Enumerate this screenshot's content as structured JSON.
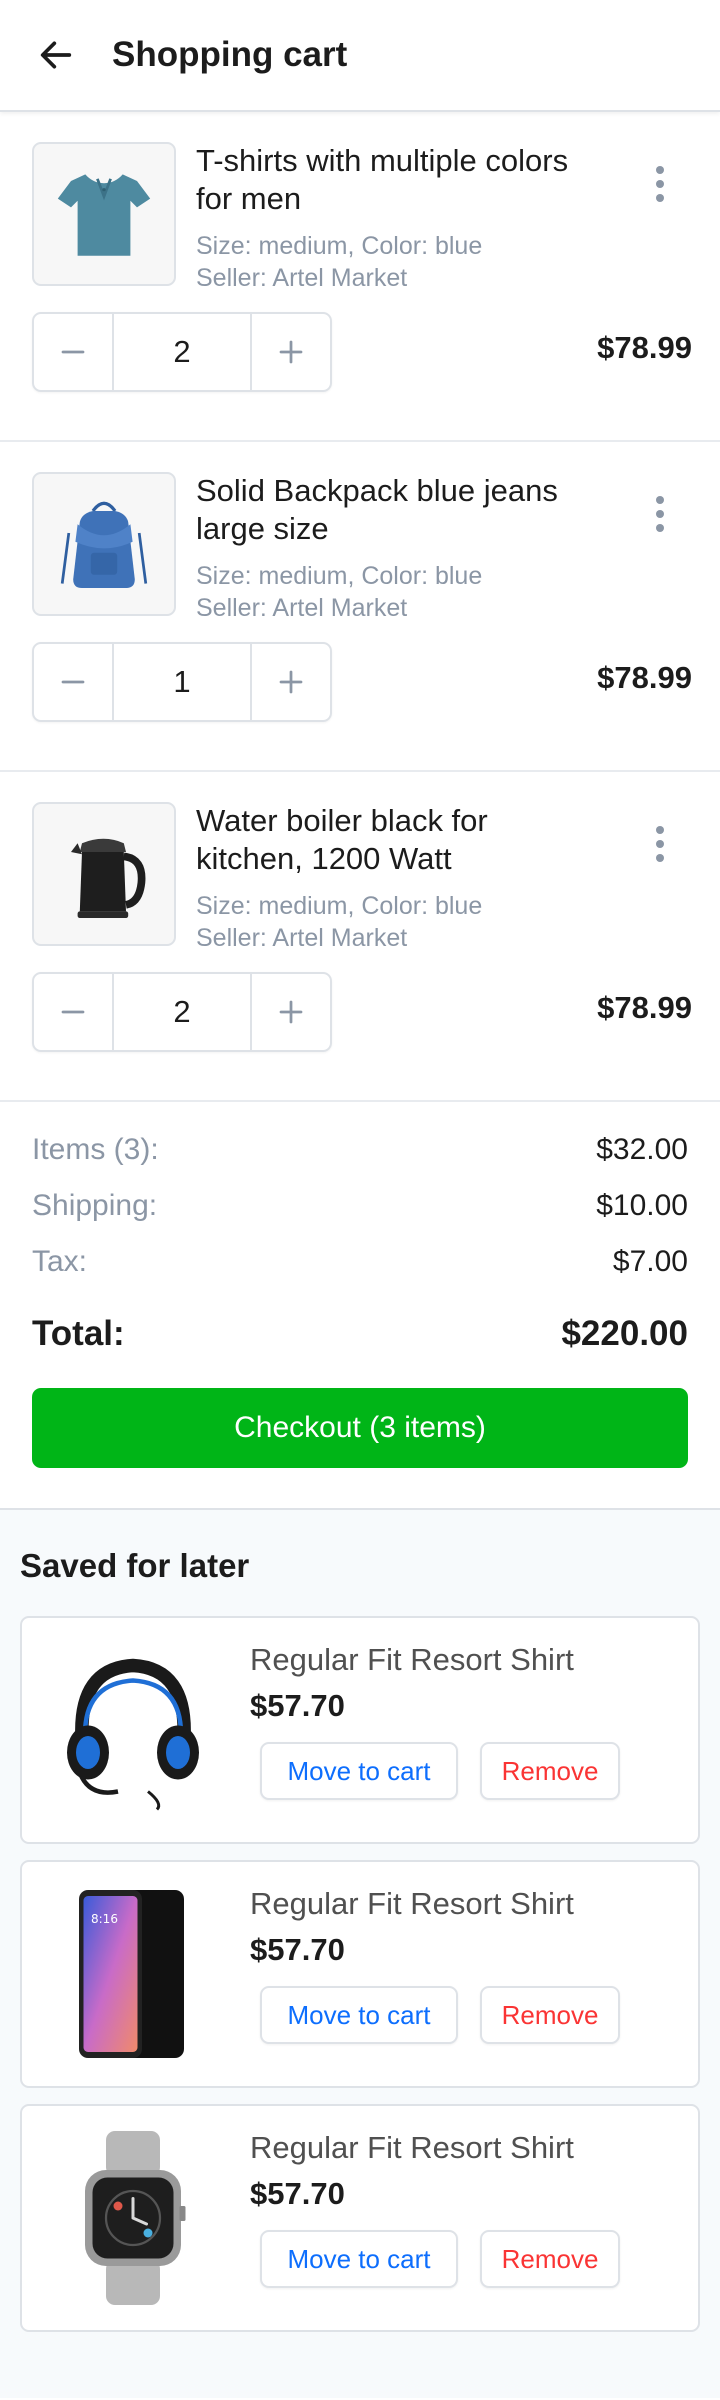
{
  "header": {
    "title": "Shopping cart"
  },
  "cart_items": [
    {
      "title": "T-shirts with multiple colors for men",
      "meta": "Size: medium, Color: blue",
      "seller": "Seller: Artel Market",
      "quantity": "2",
      "price": "$78.99"
    },
    {
      "title": "Solid Backpack blue jeans large size",
      "meta": "Size: medium, Color: blue",
      "seller": "Seller: Artel Market",
      "quantity": "1",
      "price": "$78.99"
    },
    {
      "title": "Water boiler black for kitchen, 1200 Watt",
      "meta": "Size: medium, Color: blue",
      "seller": "Seller: Artel Market",
      "quantity": "2",
      "price": "$78.99"
    }
  ],
  "summary": {
    "items_label": "Items (3):",
    "items_value": "$32.00",
    "shipping_label": "Shipping:",
    "shipping_value": "$10.00",
    "tax_label": "Tax:",
    "tax_value": "$7.00",
    "total_label": "Total:",
    "total_value": "$220.00",
    "checkout_label": "Checkout (3 items)"
  },
  "saved": {
    "title": "Saved for later",
    "items": [
      {
        "name": "Regular Fit Resort Shirt",
        "price": "$57.70",
        "move_label": "Move to cart",
        "remove_label": "Remove"
      },
      {
        "name": "Regular Fit Resort Shirt",
        "price": "$57.70",
        "move_label": "Move to cart",
        "remove_label": "Remove"
      },
      {
        "name": "Regular Fit Resort Shirt",
        "price": "$57.70",
        "move_label": "Move to cart",
        "remove_label": "Remove"
      }
    ]
  },
  "phone_screen_time": "8:16",
  "colors": {
    "accent_green": "#00b517",
    "link_blue": "#0d6efd",
    "danger_red": "#fa3434",
    "muted_gray": "#8b96a5"
  },
  "icons": [
    "arrow-left-icon",
    "more-vertical-icon",
    "minus-icon",
    "plus-icon"
  ]
}
